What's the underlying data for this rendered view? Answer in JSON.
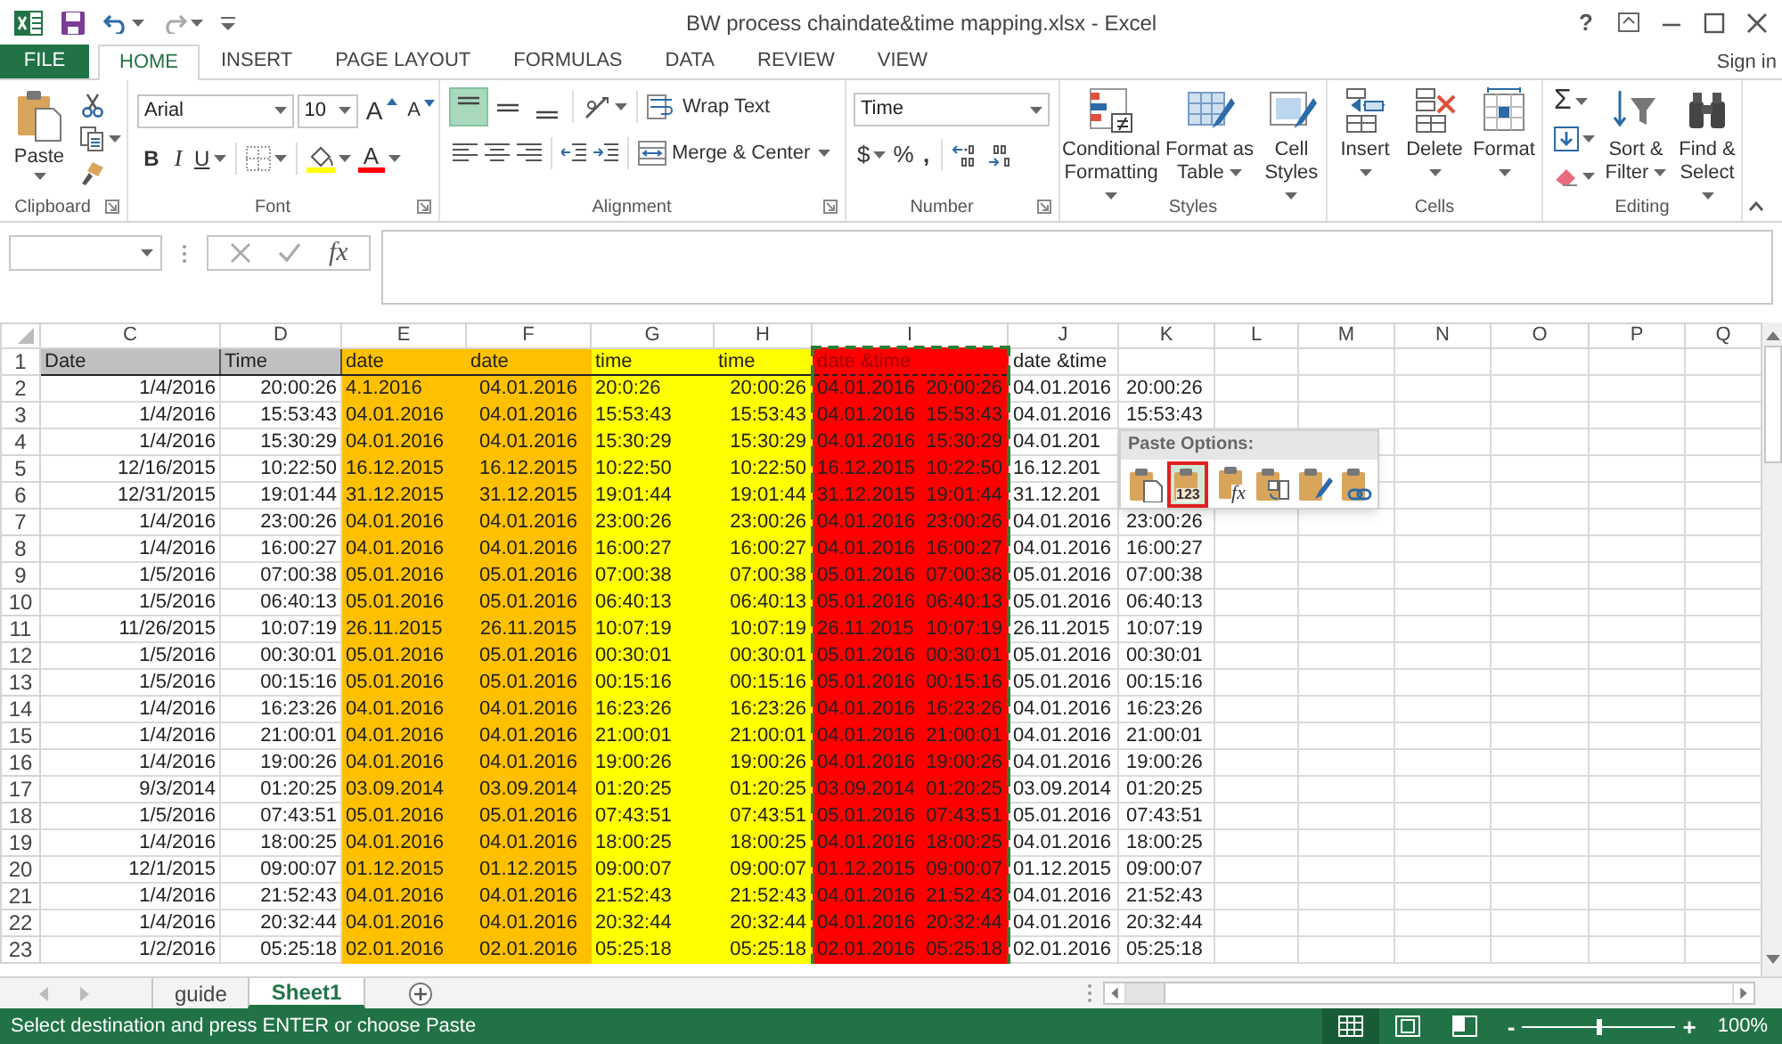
{
  "window": {
    "title": "BW process chaindate&time mapping.xlsx - Excel",
    "help": "?"
  },
  "account": "Sign in",
  "tabs": [
    {
      "label": "FILE",
      "kind": "file",
      "selected": false
    },
    {
      "label": "HOME",
      "kind": "tab",
      "selected": true
    },
    {
      "label": "INSERT",
      "kind": "tab",
      "selected": false
    },
    {
      "label": "PAGE LAYOUT",
      "kind": "tab",
      "selected": false
    },
    {
      "label": "FORMULAS",
      "kind": "tab",
      "selected": false
    },
    {
      "label": "DATA",
      "kind": "tab",
      "selected": false
    },
    {
      "label": "REVIEW",
      "kind": "tab",
      "selected": false
    },
    {
      "label": "VIEW",
      "kind": "tab",
      "selected": false
    }
  ],
  "ribbon": {
    "clipboard": {
      "label": "Clipboard",
      "paste": "Paste"
    },
    "font": {
      "label": "Font",
      "font_name": "Arial",
      "font_size": "10",
      "grow": "A",
      "shrink": "A",
      "bold": "B",
      "italic": "I",
      "underline": "U",
      "font_color": "A"
    },
    "alignment": {
      "label": "Alignment",
      "vertical_align": [
        {
          "selected": true
        },
        {
          "selected": false
        },
        {
          "selected": false
        }
      ],
      "wrap_text": "Wrap Text",
      "merge": "Merge & Center"
    },
    "number": {
      "label": "Number",
      "format": "Time",
      "currency": "$",
      "percent": "%",
      "comma": ","
    },
    "styles": {
      "label": "Styles",
      "buttons": [
        "Conditional Formatting",
        "Format as Table",
        "Cell Styles"
      ]
    },
    "cells": {
      "label": "Cells",
      "buttons": [
        "Insert",
        "Delete",
        "Format"
      ]
    },
    "editing": {
      "label": "Editing",
      "autosum": "Σ",
      "buttons": [
        "Sort & Filter",
        "Find & Select"
      ]
    }
  },
  "formula_bar": {
    "function": "fx"
  },
  "sheet": {
    "columns": [
      "C",
      "D",
      "E",
      "F",
      "G",
      "H",
      "I",
      "J",
      "K",
      "L",
      "M",
      "N",
      "O",
      "P",
      "Q"
    ],
    "header_row": {
      "number": "1",
      "cells": [
        "Date",
        "Time",
        "date",
        "date",
        "time",
        "time",
        "date &time",
        "date &time"
      ]
    },
    "rows": [
      {
        "number": "2",
        "cells": [
          "1/4/2016",
          "20:00:26",
          "4.1.2016",
          "04.01.2016",
          "20:0:26",
          "20:00:26",
          "04.01.2016 20:00:26",
          "04.01.2016",
          "20:00:26"
        ]
      },
      {
        "number": "3",
        "cells": [
          "1/4/2016",
          "15:53:43",
          "04.01.2016",
          "04.01.2016",
          "15:53:43",
          "15:53:43",
          "04.01.2016 15:53:43",
          "04.01.2016",
          "15:53:43"
        ]
      },
      {
        "number": "4",
        "cells": [
          "1/4/2016",
          "15:30:29",
          "04.01.2016",
          "04.01.2016",
          "15:30:29",
          "15:30:29",
          "04.01.2016 15:30:29",
          "04.01.201"
        ]
      },
      {
        "number": "5",
        "cells": [
          "12/16/2015",
          "10:22:50",
          "16.12.2015",
          "16.12.2015",
          "10:22:50",
          "10:22:50",
          "16.12.2015 10:22:50",
          "16.12.201"
        ]
      },
      {
        "number": "6",
        "cells": [
          "12/31/2015",
          "19:01:44",
          "31.12.2015",
          "31.12.2015",
          "19:01:44",
          "19:01:44",
          "31.12.2015 19:01:44",
          "31.12.201"
        ]
      },
      {
        "number": "7",
        "cells": [
          "1/4/2016",
          "23:00:26",
          "04.01.2016",
          "04.01.2016",
          "23:00:26",
          "23:00:26",
          "04.01.2016 23:00:26",
          "04.01.2016",
          "23:00:26"
        ]
      },
      {
        "number": "8",
        "cells": [
          "1/4/2016",
          "16:00:27",
          "04.01.2016",
          "04.01.2016",
          "16:00:27",
          "16:00:27",
          "04.01.2016 16:00:27",
          "04.01.2016",
          "16:00:27"
        ]
      },
      {
        "number": "9",
        "cells": [
          "1/5/2016",
          "07:00:38",
          "05.01.2016",
          "05.01.2016",
          "07:00:38",
          "07:00:38",
          "05.01.2016 07:00:38",
          "05.01.2016",
          "07:00:38"
        ]
      },
      {
        "number": "10",
        "cells": [
          "1/5/2016",
          "06:40:13",
          "05.01.2016",
          "05.01.2016",
          "06:40:13",
          "06:40:13",
          "05.01.2016 06:40:13",
          "05.01.2016",
          "06:40:13"
        ]
      },
      {
        "number": "11",
        "cells": [
          "11/26/2015",
          "10:07:19",
          "26.11.2015",
          "26.11.2015",
          "10:07:19",
          "10:07:19",
          "26.11.2015 10:07:19",
          "26.11.2015",
          "10:07:19"
        ]
      },
      {
        "number": "12",
        "cells": [
          "1/5/2016",
          "00:30:01",
          "05.01.2016",
          "05.01.2016",
          "00:30:01",
          "00:30:01",
          "05.01.2016 00:30:01",
          "05.01.2016",
          "00:30:01"
        ]
      },
      {
        "number": "13",
        "cells": [
          "1/5/2016",
          "00:15:16",
          "05.01.2016",
          "05.01.2016",
          "00:15:16",
          "00:15:16",
          "05.01.2016 00:15:16",
          "05.01.2016",
          "00:15:16"
        ]
      },
      {
        "number": "14",
        "cells": [
          "1/4/2016",
          "16:23:26",
          "04.01.2016",
          "04.01.2016",
          "16:23:26",
          "16:23:26",
          "04.01.2016 16:23:26",
          "04.01.2016",
          "16:23:26"
        ]
      },
      {
        "number": "15",
        "cells": [
          "1/4/2016",
          "21:00:01",
          "04.01.2016",
          "04.01.2016",
          "21:00:01",
          "21:00:01",
          "04.01.2016 21:00:01",
          "04.01.2016",
          "21:00:01"
        ]
      },
      {
        "number": "16",
        "cells": [
          "1/4/2016",
          "19:00:26",
          "04.01.2016",
          "04.01.2016",
          "19:00:26",
          "19:00:26",
          "04.01.2016 19:00:26",
          "04.01.2016",
          "19:00:26"
        ]
      },
      {
        "number": "17",
        "cells": [
          "9/3/2014",
          "01:20:25",
          "03.09.2014",
          "03.09.2014",
          "01:20:25",
          "01:20:25",
          "03.09.2014 01:20:25",
          "03.09.2014",
          "01:20:25"
        ]
      },
      {
        "number": "18",
        "cells": [
          "1/5/2016",
          "07:43:51",
          "05.01.2016",
          "05.01.2016",
          "07:43:51",
          "07:43:51",
          "05.01.2016 07:43:51",
          "05.01.2016",
          "07:43:51"
        ]
      },
      {
        "number": "19",
        "cells": [
          "1/4/2016",
          "18:00:25",
          "04.01.2016",
          "04.01.2016",
          "18:00:25",
          "18:00:25",
          "04.01.2016 18:00:25",
          "04.01.2016",
          "18:00:25"
        ]
      },
      {
        "number": "20",
        "cells": [
          "12/1/2015",
          "09:00:07",
          "01.12.2015",
          "01.12.2015",
          "09:00:07",
          "09:00:07",
          "01.12.2015 09:00:07",
          "01.12.2015",
          "09:00:07"
        ]
      },
      {
        "number": "21",
        "cells": [
          "1/4/2016",
          "21:52:43",
          "04.01.2016",
          "04.01.2016",
          "21:52:43",
          "21:52:43",
          "04.01.2016 21:52:43",
          "04.01.2016",
          "21:52:43"
        ]
      },
      {
        "number": "22",
        "cells": [
          "1/4/2016",
          "20:32:44",
          "04.01.2016",
          "04.01.2016",
          "20:32:44",
          "20:32:44",
          "04.01.2016 20:32:44",
          "04.01.2016",
          "20:32:44"
        ]
      },
      {
        "number": "23",
        "cells": [
          "1/2/2016",
          "05:25:18",
          "02.01.2016",
          "02.01.2016",
          "05:25:18",
          "05:25:18",
          "02.01.2016 05:25:18",
          "02.01.2016",
          "05:25:18"
        ]
      }
    ]
  },
  "paste_options": {
    "title": "Paste Options:",
    "options": [
      {
        "kind": "paste",
        "selected": false
      },
      {
        "kind": "values",
        "text": "123",
        "selected": true
      },
      {
        "kind": "formulas",
        "text": "fx",
        "selected": false
      },
      {
        "kind": "transpose",
        "selected": false
      },
      {
        "kind": "formatting",
        "selected": false
      },
      {
        "kind": "link",
        "selected": false
      }
    ]
  },
  "sheet_tabs": [
    {
      "label": "guide",
      "selected": false
    },
    {
      "label": "Sheet1",
      "selected": true
    }
  ],
  "status_bar": {
    "message": "Select destination and press ENTER or choose Paste",
    "views": [
      {
        "kind": "normal",
        "selected": true
      },
      {
        "kind": "page_layout",
        "selected": false
      },
      {
        "kind": "page_break",
        "selected": false
      }
    ],
    "zoom_out": "-",
    "zoom_in": "+",
    "zoom": {
      "level": 0.5
    },
    "zoom_text": "100%"
  }
}
